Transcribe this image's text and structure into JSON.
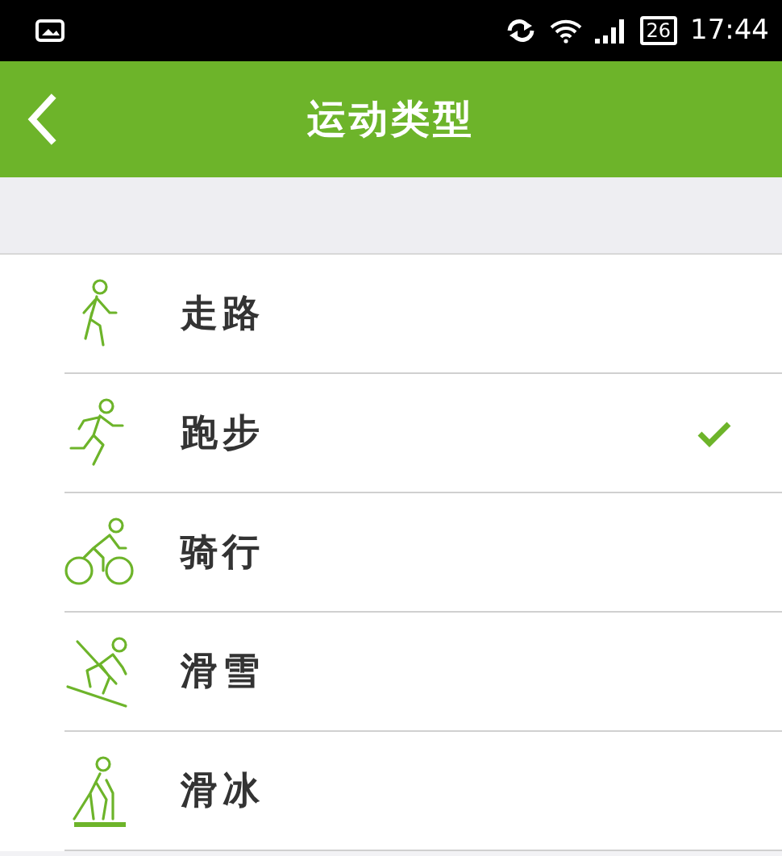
{
  "status_bar": {
    "battery": "26",
    "time": "17:44"
  },
  "header": {
    "title": "运动类型"
  },
  "sports": [
    {
      "kind": "walk",
      "label": "走路",
      "selected": false
    },
    {
      "kind": "run",
      "label": "跑步",
      "selected": true
    },
    {
      "kind": "cycle",
      "label": "骑行",
      "selected": false
    },
    {
      "kind": "ski",
      "label": "滑雪",
      "selected": false
    },
    {
      "kind": "skate",
      "label": "滑冰",
      "selected": false
    }
  ]
}
